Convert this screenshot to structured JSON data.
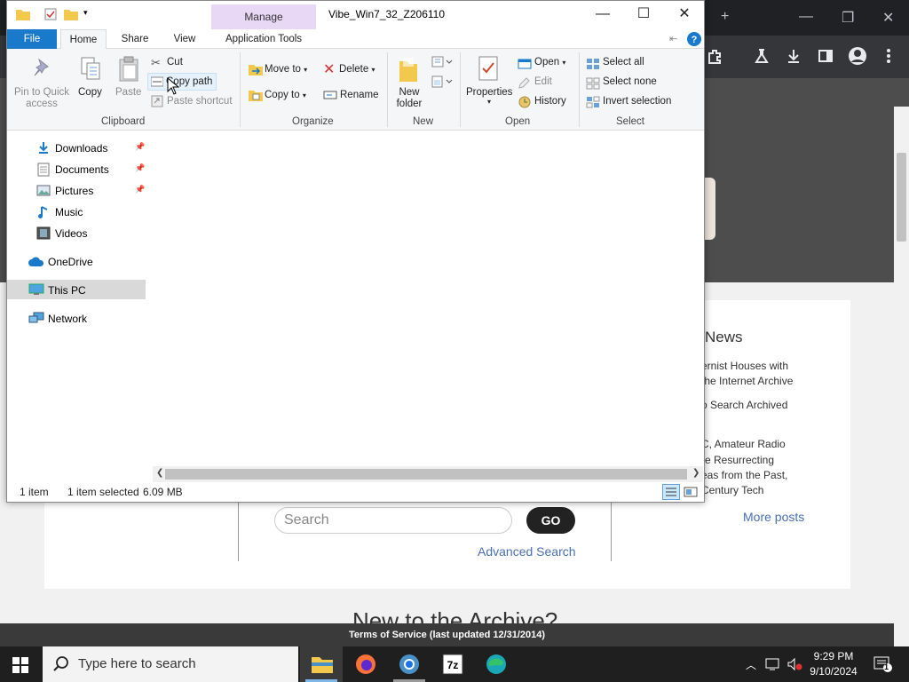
{
  "browser": {
    "footer_text": "Terms of Service (last updated 12/31/2014)",
    "new_to_archive": "New to the Archive?",
    "news_title": "News",
    "news_lines": [
      "ernist Houses with",
      "the Internet Archive",
      "o Search Archived",
      "C, Amateur Radio",
      "re Resurrecting",
      "eas from the Past,",
      "Century Tech"
    ],
    "more_posts": "More posts",
    "search_placeholder": "Search",
    "go_label": "GO",
    "advanced_search": "Advanced Search",
    "controls": {
      "new_tab": "+",
      "minimize": "—",
      "restore": "❐",
      "close": "✕"
    }
  },
  "explorer": {
    "title": "Vibe_Win7_32_Z206110",
    "manage_tab": "Manage",
    "tabs": {
      "file": "File",
      "home": "Home",
      "share": "Share",
      "view": "View",
      "application_tools": "Application Tools"
    },
    "ribbon": {
      "pin_line1": "Pin to Quick",
      "pin_line2": "access",
      "copy": "Copy",
      "paste": "Paste",
      "cut": "Cut",
      "copy_path": "Copy path",
      "paste_shortcut": "Paste shortcut",
      "clipboard": "Clipboard",
      "move_to": "Move to",
      "copy_to": "Copy to",
      "delete": "Delete",
      "rename": "Rename",
      "organize": "Organize",
      "new_folder_line1": "New",
      "new_folder_line2": "folder",
      "new": "New",
      "properties": "Properties",
      "open": "Open",
      "edit": "Edit",
      "history": "History",
      "open_group": "Open",
      "select_all": "Select all",
      "select_none": "Select none",
      "invert_selection": "Invert selection",
      "select_group": "Select"
    },
    "nav": {
      "downloads": "Downloads",
      "documents": "Documents",
      "pictures": "Pictures",
      "music": "Music",
      "videos": "Videos",
      "onedrive": "OneDrive",
      "this_pc": "This PC",
      "network": "Network"
    },
    "status": {
      "items": "1 item",
      "selected": "1 item selected",
      "size": "6.09 MB"
    }
  },
  "taskbar": {
    "search_placeholder": "Type here to search",
    "time": "9:29 PM",
    "date": "9/10/2024",
    "notification_count": "1"
  }
}
